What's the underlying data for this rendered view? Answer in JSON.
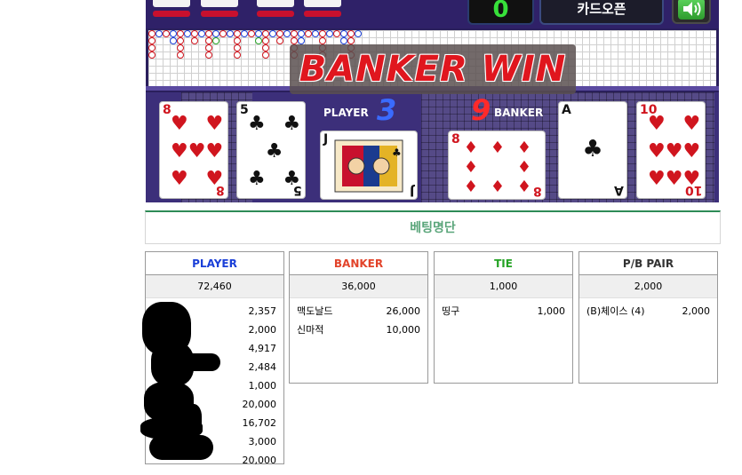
{
  "game": {
    "counter": "0",
    "card_open_label": "카드오픈",
    "banner": "BANKER WIN",
    "player_label": "PLAYER",
    "player_score": "3",
    "banker_label": "BANKER",
    "banker_score": "9",
    "player_cards": [
      {
        "rank": "8",
        "suit": "♥",
        "color": "red"
      },
      {
        "rank": "5",
        "suit": "♣",
        "color": "black"
      },
      {
        "rank": "J",
        "suit": "♣",
        "color": "black"
      }
    ],
    "banker_cards": [
      {
        "rank": "8",
        "suit": "♦",
        "color": "red"
      },
      {
        "rank": "A",
        "suit": "♣",
        "color": "black"
      },
      {
        "rank": "10",
        "suit": "♥",
        "color": "red"
      }
    ]
  },
  "bet_list": {
    "title": "베팅명단",
    "columns": [
      {
        "name": "PLAYER",
        "color": "#1a3fd8",
        "total": "72,460",
        "rows": [
          {
            "user": "",
            "amount": "2,357"
          },
          {
            "user": "",
            "amount": "2,000"
          },
          {
            "user": "",
            "amount": "4,917"
          },
          {
            "user": "",
            "amount": "2,484"
          },
          {
            "user": "",
            "amount": "1,000"
          },
          {
            "user": "",
            "amount": "20,000"
          },
          {
            "user": "",
            "amount": "16,702"
          },
          {
            "user": "",
            "amount": "3,000"
          },
          {
            "user": "",
            "amount": "20,000"
          }
        ]
      },
      {
        "name": "BANKER",
        "color": "#e2432a",
        "total": "36,000",
        "rows": [
          {
            "user": "맥도날드",
            "amount": "26,000"
          },
          {
            "user": "신마적",
            "amount": "10,000"
          }
        ]
      },
      {
        "name": "TIE",
        "color": "#25a325",
        "total": "1,000",
        "rows": [
          {
            "user": "띵구",
            "amount": "1,000"
          }
        ]
      },
      {
        "name": "P/B PAIR",
        "color": "#333333",
        "total": "2,000",
        "rows": [
          {
            "user": "(B)체이스 (4)",
            "amount": "2,000"
          }
        ]
      }
    ]
  }
}
